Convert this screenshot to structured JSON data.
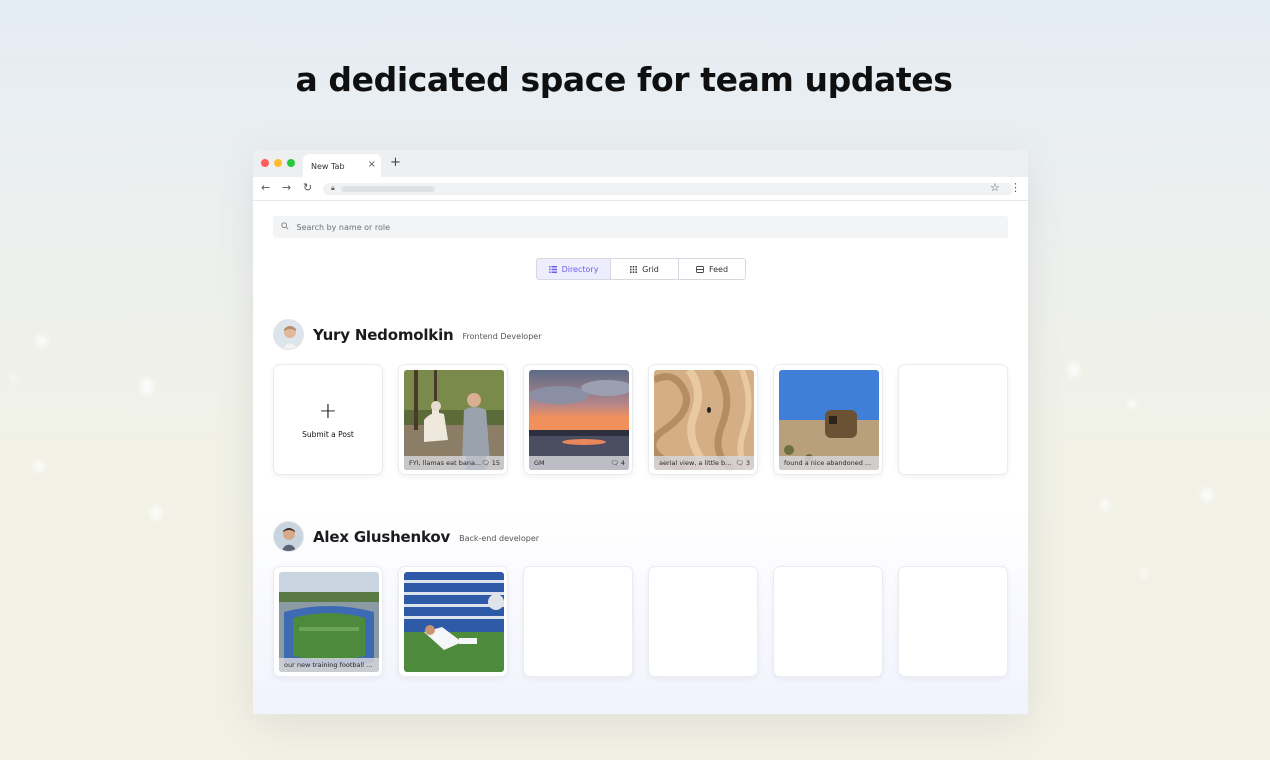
{
  "headline": "a dedicated space for team updates",
  "browser": {
    "tab_title": "New Tab",
    "close_glyph": "×",
    "new_tab_glyph": "+",
    "back_glyph": "←",
    "forward_glyph": "→",
    "reload_glyph": "↻",
    "star_glyph": "☆",
    "menu_glyph": "⋮",
    "traffic_lights": [
      "#ff5f57",
      "#febc2e",
      "#28c840"
    ]
  },
  "search": {
    "placeholder": "Search by name or role",
    "icon": "search-icon"
  },
  "view_switcher": {
    "active": "Directory",
    "options": [
      {
        "label": "Directory",
        "icon": "list-icon"
      },
      {
        "label": "Grid",
        "icon": "grid-icon"
      },
      {
        "label": "Feed",
        "icon": "feed-icon"
      }
    ]
  },
  "users": [
    {
      "name": "Yury Nedomolkin",
      "role": "Frontend Developer",
      "submit_label": "Submit a Post",
      "plus_glyph": "+",
      "posts": [
        {
          "caption": "FYI, llamas eat bana...",
          "comments": "15"
        },
        {
          "caption": "GM",
          "comments": "4"
        },
        {
          "caption": "aerial view, a little bu...",
          "comments": "3"
        },
        {
          "caption": "found a nice abandoned ..."
        }
      ],
      "empty_slots": 1
    },
    {
      "name": "Alex Glushenkov",
      "role": "Back-end developer",
      "posts": [
        {
          "caption": "our new training football ..."
        },
        {
          "caption": ""
        }
      ],
      "empty_slots": 4
    }
  ],
  "colors": {
    "accent": "#6a5ef2",
    "accent_bg": "#eeedfd"
  }
}
